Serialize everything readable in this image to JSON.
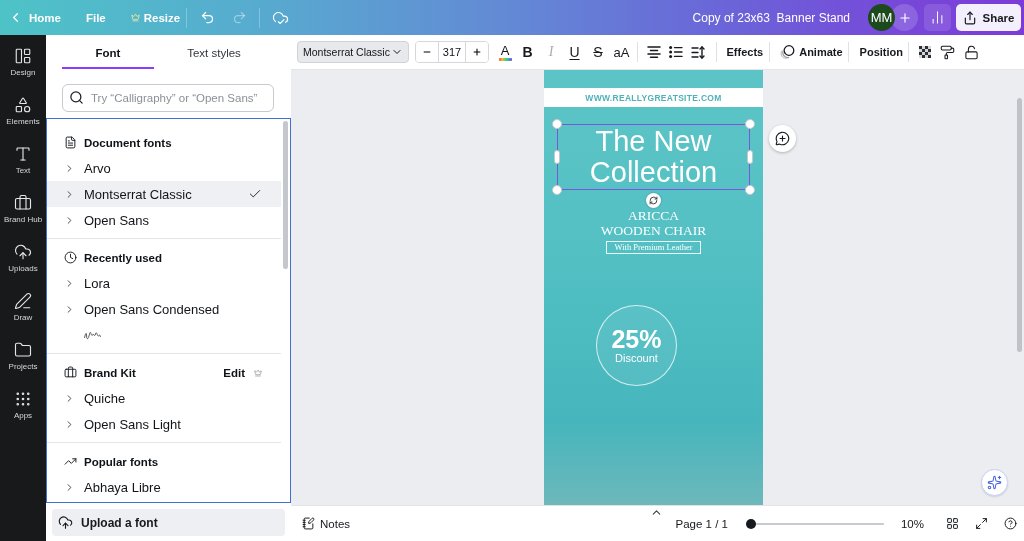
{
  "top_bar": {
    "home": "Home",
    "file": "File",
    "resize": "Resize",
    "history": [
      {
        "kind": "undo",
        "disabled": false
      },
      {
        "kind": "redo",
        "disabled": true
      }
    ],
    "title": "Copy of 23x63  Banner Stand",
    "avatar": "MM",
    "share": "Share"
  },
  "rail": [
    {
      "kind": "design",
      "label": "Design"
    },
    {
      "kind": "elements",
      "label": "Elements"
    },
    {
      "kind": "text",
      "label": "Text"
    },
    {
      "kind": "brand",
      "label": "Brand Hub"
    },
    {
      "kind": "uploads",
      "label": "Uploads"
    },
    {
      "kind": "draw",
      "label": "Draw"
    },
    {
      "kind": "projects",
      "label": "Projects"
    },
    {
      "kind": "apps",
      "label": "Apps"
    }
  ],
  "font_panel": {
    "tabs": [
      {
        "label": "Font",
        "selected": true
      },
      {
        "label": "Text styles",
        "selected": false
      }
    ],
    "search": {
      "placeholder": "Try “Calligraphy” or “Open Sans”"
    },
    "sections": [
      {
        "kind": "document",
        "title": "Document fonts",
        "fonts": [
          {
            "kind": "family",
            "name": "Arvo",
            "selected": false
          },
          {
            "kind": "family",
            "name": "Montserrat Classic",
            "selected": true
          },
          {
            "kind": "family",
            "name": "Open Sans",
            "selected": false
          }
        ]
      },
      {
        "kind": "recent",
        "title": "Recently used",
        "fonts": [
          {
            "kind": "family",
            "name": "Lora",
            "selected": false
          },
          {
            "kind": "family",
            "name": "Open Sans Condensed",
            "selected": false
          },
          {
            "kind": "preview",
            "selected": false
          }
        ]
      },
      {
        "kind": "brand",
        "title": "Brand Kit",
        "action": "Edit",
        "fonts": [
          {
            "kind": "family",
            "name": "Quiche",
            "selected": false
          },
          {
            "kind": "family",
            "name": "Open Sans Light",
            "selected": false
          }
        ]
      },
      {
        "kind": "popular",
        "title": "Popular fonts",
        "fonts": [
          {
            "kind": "family",
            "name": "Abhaya Libre",
            "selected": false
          }
        ]
      }
    ],
    "upload": "Upload a font"
  },
  "toolbar": {
    "font": "Montserrat Classic",
    "size": "317",
    "color_label": "A",
    "format": [
      {
        "kind": "bold",
        "label": "B",
        "disabled": false
      },
      {
        "kind": "italic",
        "label": "I",
        "disabled": true
      },
      {
        "kind": "underline",
        "label": "U",
        "disabled": false
      },
      {
        "kind": "strike",
        "label": "S",
        "disabled": false
      },
      {
        "kind": "case",
        "label": "aA",
        "disabled": false
      }
    ],
    "effects": "Effects",
    "animate": "Animate",
    "position": "Position"
  },
  "poster": {
    "url": "WWW.REALLYGREATSITE.COM",
    "headline": "The New Collection",
    "selected": true,
    "product": [
      "ARICCA",
      "WOODEN CHAIR"
    ],
    "tagline": "With Premium Leather",
    "discount": "25%",
    "discount_label": "Discount"
  },
  "bottom_bar": {
    "notes": "Notes",
    "page": "Page 1 / 1",
    "zoom": {
      "level": 0,
      "reading": "10%"
    }
  }
}
